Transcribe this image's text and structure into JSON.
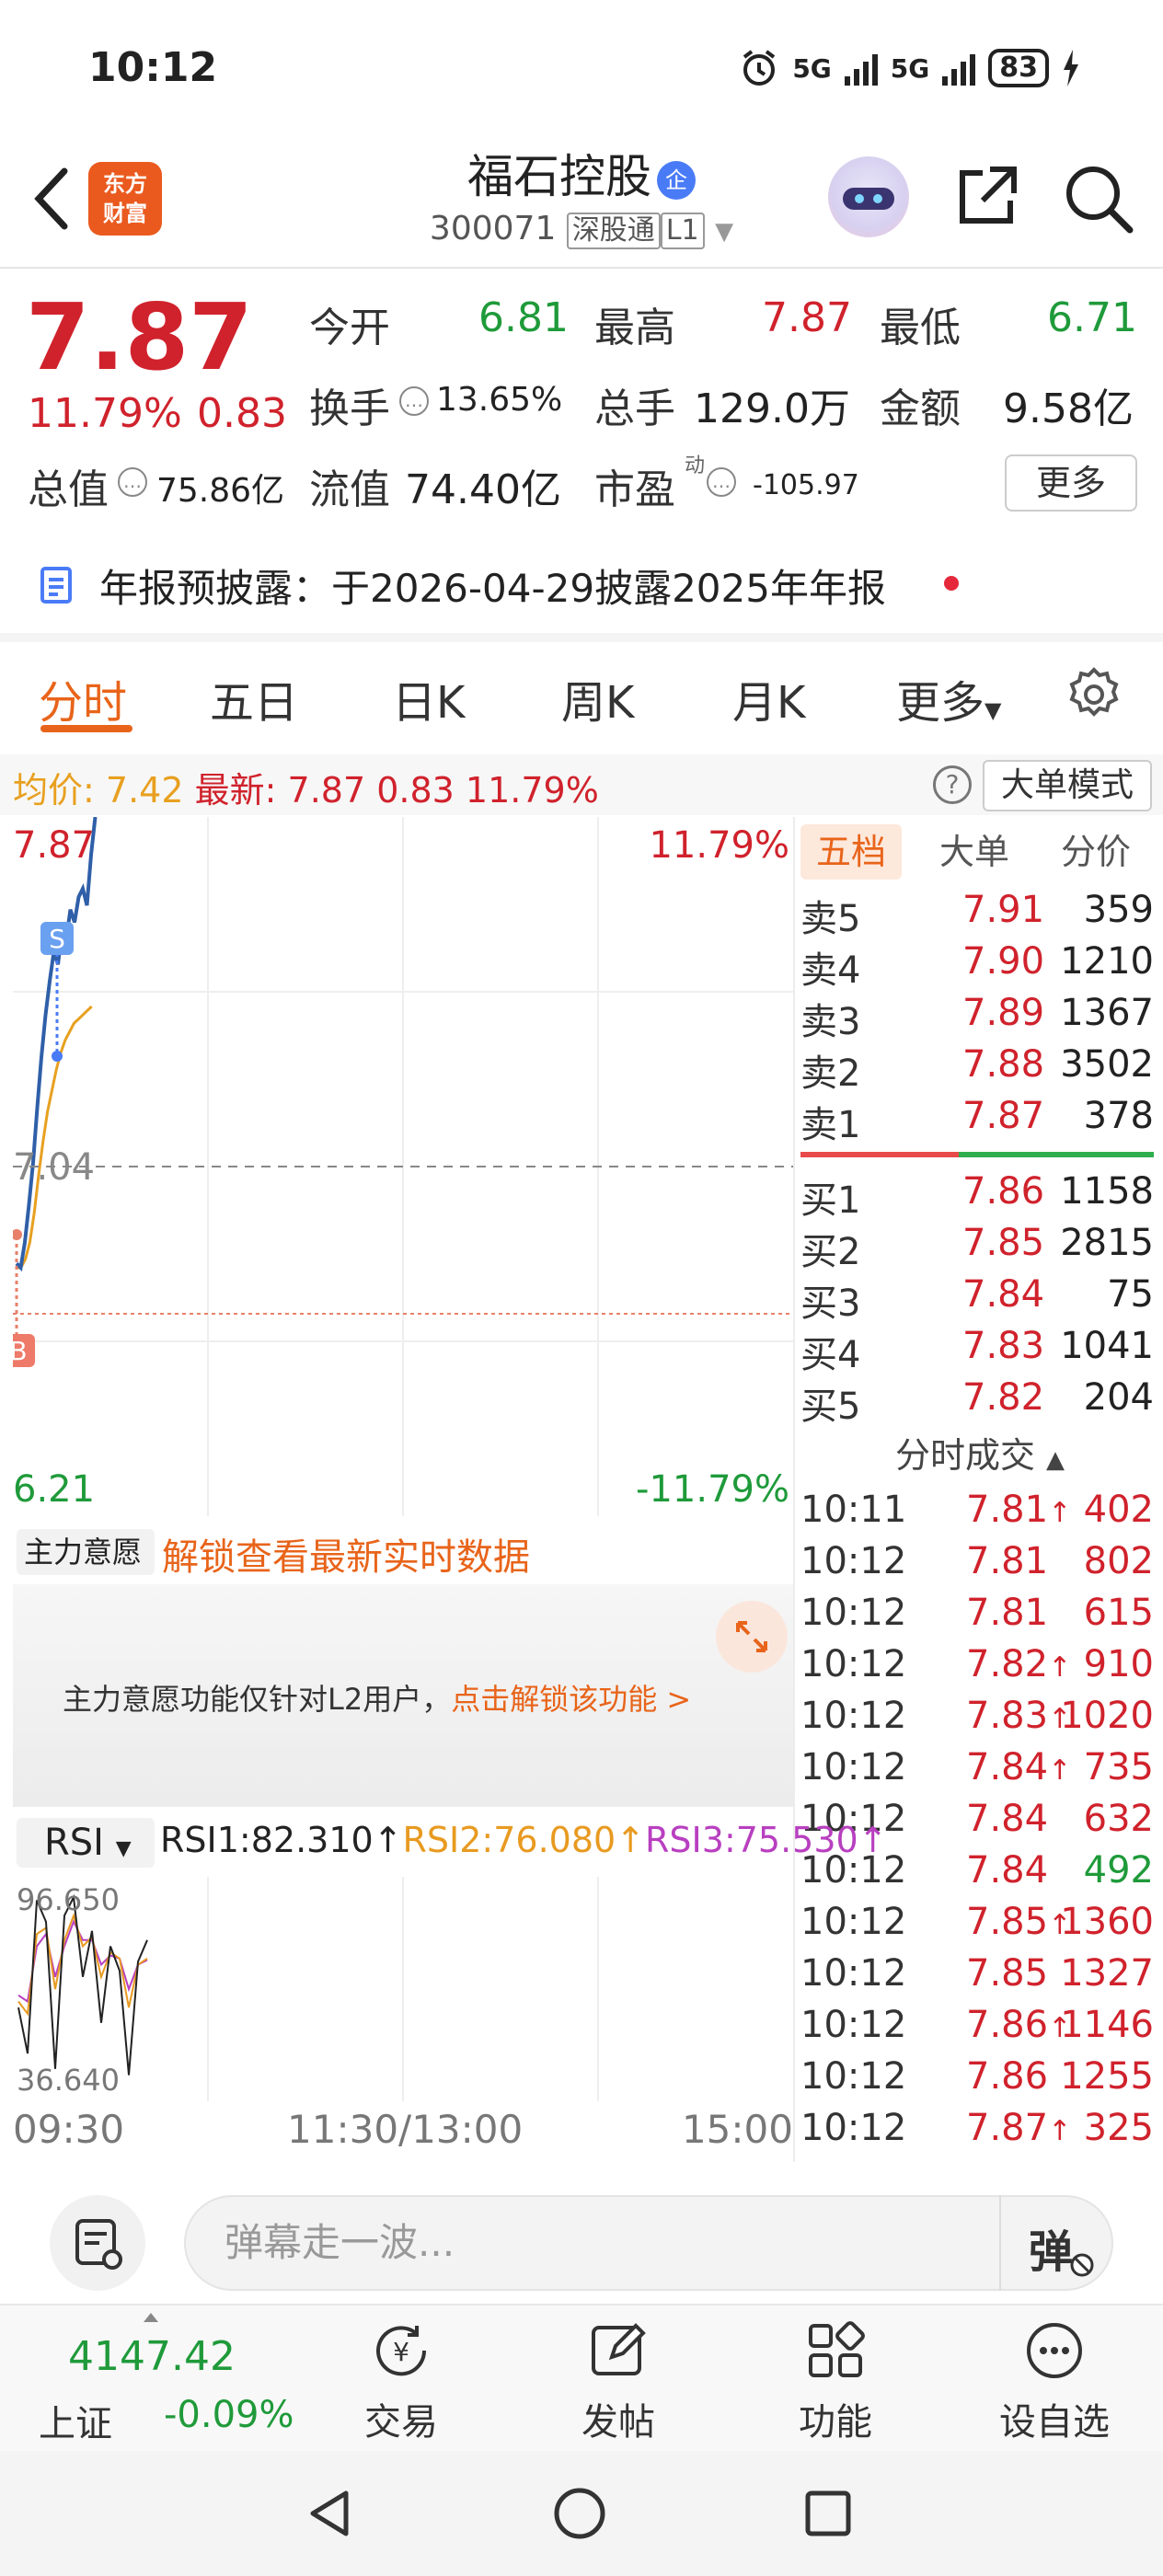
{
  "status": {
    "time": "10:12",
    "signal1": "5G",
    "signal2": "5G",
    "battery": "83"
  },
  "header": {
    "logo_line1": "东方",
    "logo_line2": "财富",
    "stock_name": "福石控股",
    "name_badge": "企",
    "code": "300071",
    "tag1": "深股通",
    "tag2": "L1"
  },
  "quote": {
    "price": "7.87",
    "pct": "11.79%",
    "chg": "0.83",
    "open_label": "今开",
    "open": "6.81",
    "high_label": "最高",
    "high": "7.87",
    "low_label": "最低",
    "low": "6.71",
    "turnover_label": "换手",
    "turnover": "13.65%",
    "volume_label": "总手",
    "volume": "129.0万",
    "amount_label": "金额",
    "amount": "9.58亿",
    "mcap_label": "总值",
    "mcap": "75.86亿",
    "float_label": "流值",
    "float": "74.40亿",
    "pe_label": "市盈",
    "pe_sup": "动",
    "pe": "-105.97",
    "more": "更多"
  },
  "notice": {
    "text": "年报预披露：于2026-04-29披露2025年年报"
  },
  "tabs": [
    "分时",
    "五日",
    "日K",
    "周K",
    "月K",
    "更多"
  ],
  "info_row": {
    "avg_label": "均价:",
    "avg": "7.42",
    "latest_label": "最新:",
    "latest": "7.87",
    "latest_chg": "0.83",
    "latest_pct": "11.79%",
    "help": "?",
    "mode": "大单模式"
  },
  "chart": {
    "top_price": "7.87",
    "top_pct": "11.79%",
    "mid_price": "7.04",
    "bottom_price": "6.21",
    "bottom_pct": "-11.79%",
    "sell_marker": "S",
    "buy_marker": "B"
  },
  "chart_data": {
    "type": "line",
    "ylim": [
      6.21,
      7.87
    ],
    "reference": 7.04,
    "series": [
      {
        "values": [
          6.81,
          6.8,
          6.86,
          6.95,
          7.05,
          7.18,
          7.3,
          7.4,
          7.48,
          7.55,
          7.52,
          7.6,
          7.58,
          7.65,
          7.62,
          7.68,
          7.7,
          7.66,
          7.78,
          7.87
        ]
      },
      {
        "values": [
          6.8,
          6.8,
          6.82,
          6.86,
          6.93,
          7.02,
          7.1,
          7.17,
          7.22,
          7.27,
          7.31,
          7.34,
          7.36,
          7.38,
          7.39,
          7.4,
          7.41,
          7.42
        ]
      }
    ]
  },
  "orderbook": {
    "tabs": [
      "五档",
      "大单",
      "分价"
    ],
    "sells": [
      {
        "label": "卖5",
        "price": "7.91",
        "vol": "359"
      },
      {
        "label": "卖4",
        "price": "7.90",
        "vol": "1210"
      },
      {
        "label": "卖3",
        "price": "7.89",
        "vol": "1367"
      },
      {
        "label": "卖2",
        "price": "7.88",
        "vol": "3502"
      },
      {
        "label": "卖1",
        "price": "7.87",
        "vol": "378"
      }
    ],
    "buys": [
      {
        "label": "买1",
        "price": "7.86",
        "vol": "1158"
      },
      {
        "label": "买2",
        "price": "7.85",
        "vol": "2815"
      },
      {
        "label": "买3",
        "price": "7.84",
        "vol": "75"
      },
      {
        "label": "买4",
        "price": "7.83",
        "vol": "1041"
      },
      {
        "label": "买5",
        "price": "7.82",
        "vol": "204"
      }
    ],
    "trades_title": "分时成交",
    "trades": [
      {
        "time": "10:11",
        "price": "7.81",
        "arrow": "↑",
        "vol": "402",
        "color": "#d0222c"
      },
      {
        "time": "10:12",
        "price": "7.81",
        "arrow": "",
        "vol": "802",
        "color": "#d0222c"
      },
      {
        "time": "10:12",
        "price": "7.81",
        "arrow": "",
        "vol": "615",
        "color": "#d0222c"
      },
      {
        "time": "10:12",
        "price": "7.82",
        "arrow": "↑",
        "vol": "910",
        "color": "#d0222c"
      },
      {
        "time": "10:12",
        "price": "7.83",
        "arrow": "↑",
        "vol": "1020",
        "color": "#d0222c"
      },
      {
        "time": "10:12",
        "price": "7.84",
        "arrow": "↑",
        "vol": "735",
        "color": "#d0222c"
      },
      {
        "time": "10:12",
        "price": "7.84",
        "arrow": "",
        "vol": "632",
        "color": "#d0222c"
      },
      {
        "time": "10:12",
        "price": "7.84",
        "arrow": "",
        "vol": "492",
        "color": "#1f9a3a"
      },
      {
        "time": "10:12",
        "price": "7.85",
        "arrow": "↑",
        "vol": "1360",
        "color": "#d0222c"
      },
      {
        "time": "10:12",
        "price": "7.85",
        "arrow": "",
        "vol": "1327",
        "color": "#d0222c"
      },
      {
        "time": "10:12",
        "price": "7.86",
        "arrow": "↑",
        "vol": "1146",
        "color": "#d0222c"
      },
      {
        "time": "10:12",
        "price": "7.86",
        "arrow": "",
        "vol": "1255",
        "color": "#d0222c"
      },
      {
        "time": "10:12",
        "price": "7.87",
        "arrow": "↑",
        "vol": "325",
        "color": "#d0222c"
      }
    ]
  },
  "mainforce": {
    "select": "主力意愿",
    "unlock": "解锁查看最新实时数据",
    "text": "主力意愿功能仅针对L2用户，",
    "link": "点击解锁该功能 >"
  },
  "rsi": {
    "select": "RSI",
    "rsi1": "RSI1:82.310↑",
    "rsi2": "RSI2:76.080↑",
    "rsi3": "RSI3:75.530↑",
    "top": "96.650",
    "bottom": "36.640",
    "color1": "#222222",
    "color2": "#e89a20",
    "color3": "#b83fc0"
  },
  "time_axis": {
    "start": "09:30",
    "mid": "11:30/13:00",
    "end": "15:00"
  },
  "comment": {
    "placeholder": "弹幕走一波...",
    "danmu": "弹"
  },
  "bottom_nav": {
    "index_value": "4147.42",
    "index_name": "上证",
    "index_change": "-0.09%",
    "items": [
      "交易",
      "发帖",
      "功能",
      "设自选"
    ]
  }
}
